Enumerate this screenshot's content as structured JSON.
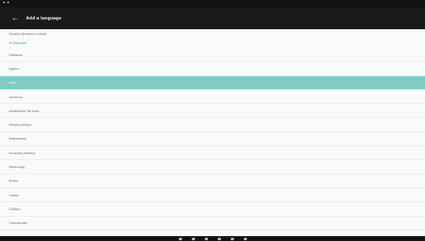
{
  "app_bar": {
    "back_icon": "arrow-back-icon",
    "title": "Add a language"
  },
  "languages": {
    "top_item": "Español (Estados Unidos)",
    "section_header": "All languages",
    "items": [
      "Afrikaans",
      "Aghem",
      "Akan",
      "Asturianu",
      "Azərbaycan dili Azəri",
      "Bahasa Melayu",
      "Bamanakan",
      "Bosanski (latinica)",
      "Brezhoneg",
      "Bosnu",
      "Català",
      "Čeština",
      "Chimakonde"
    ],
    "selected_index": 2
  },
  "colors": {
    "accent": "#26a69a",
    "selected_row": "#80cbc4",
    "app_bar": "#1a1a1a"
  }
}
